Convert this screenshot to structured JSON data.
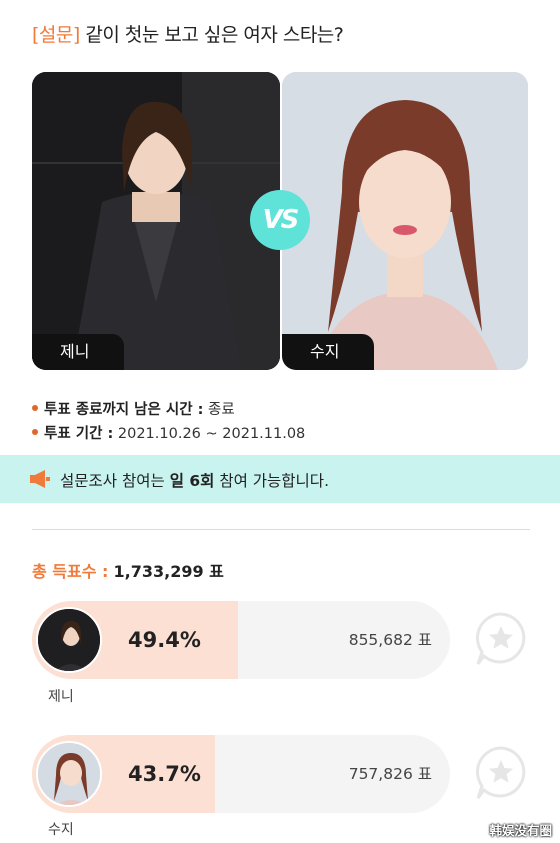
{
  "header": {
    "tag": "[설문]",
    "title": "같이 첫눈 보고 싶은 여자 스타는?"
  },
  "candidates": [
    {
      "name": "제니"
    },
    {
      "name": "수지"
    }
  ],
  "vs_label": "VS",
  "info": {
    "remaining_label": "투표 종료까지 남은 시간 :",
    "remaining_value": "종료",
    "period_label": "투표 기간 :",
    "period_value": "2021.10.26 ~ 2021.11.08"
  },
  "notice": {
    "text_before": "설문조사 참여는 ",
    "text_bold": "일 6회",
    "text_after": " 참여 가능합니다."
  },
  "total": {
    "label": "총 득표수 :",
    "value": "1,733,299 표"
  },
  "results": [
    {
      "name": "제니",
      "percent_label": "49.4%",
      "percent": 49.4,
      "count": "855,682 표"
    },
    {
      "name": "수지",
      "percent_label": "43.7%",
      "percent": 43.7,
      "count": "757,826 표"
    }
  ],
  "watermark": "韩娱没有圈",
  "colors": {
    "accent": "#f07a3a",
    "vs": "#5fe3d9",
    "notice_bg": "#c8f3ef",
    "bar_fill": "#fde0d4"
  }
}
